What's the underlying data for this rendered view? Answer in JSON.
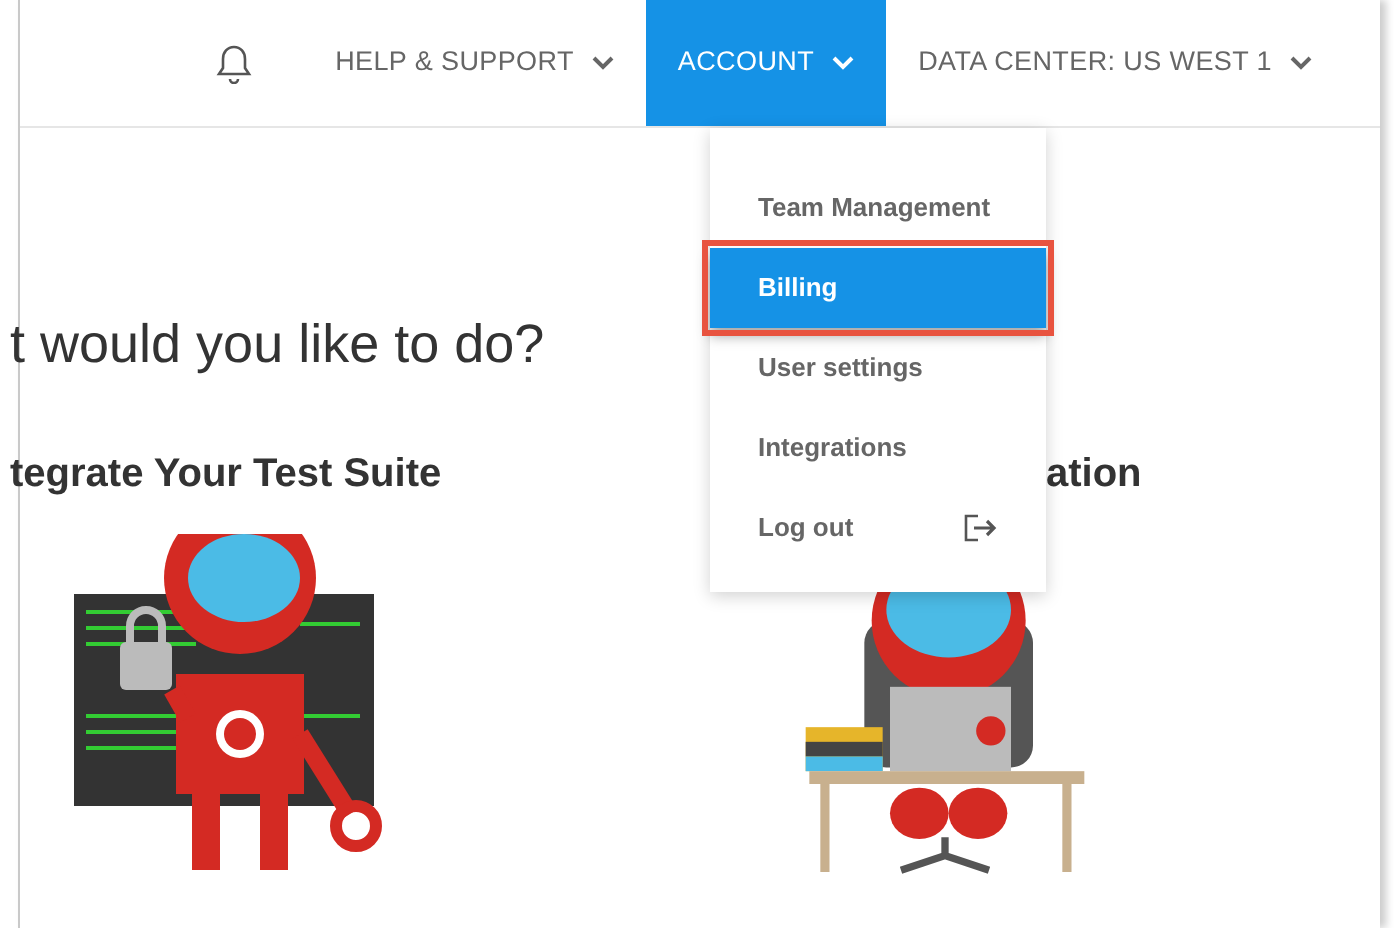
{
  "nav": {
    "items": [
      {
        "label": "HELP & SUPPORT",
        "selected": false
      },
      {
        "label": "ACCOUNT",
        "selected": true
      },
      {
        "label": "DATA CENTER: US WEST 1",
        "selected": false
      }
    ]
  },
  "account_menu": {
    "items": [
      {
        "label": "Team Management",
        "kind": "link",
        "selected": false,
        "highlighted": false
      },
      {
        "label": "Billing",
        "kind": "link",
        "selected": true,
        "highlighted": true
      },
      {
        "label": "User settings",
        "kind": "link",
        "selected": false,
        "highlighted": false
      },
      {
        "label": "Integrations",
        "kind": "link",
        "selected": false,
        "highlighted": false
      },
      {
        "label": "Log out",
        "kind": "logout",
        "selected": false,
        "highlighted": false
      }
    ]
  },
  "heading": "t would you like to do?",
  "options": [
    {
      "title": "tegrate Your Test Suite",
      "kind": "security"
    },
    {
      "title": "ation",
      "kind": "desk"
    }
  ]
}
